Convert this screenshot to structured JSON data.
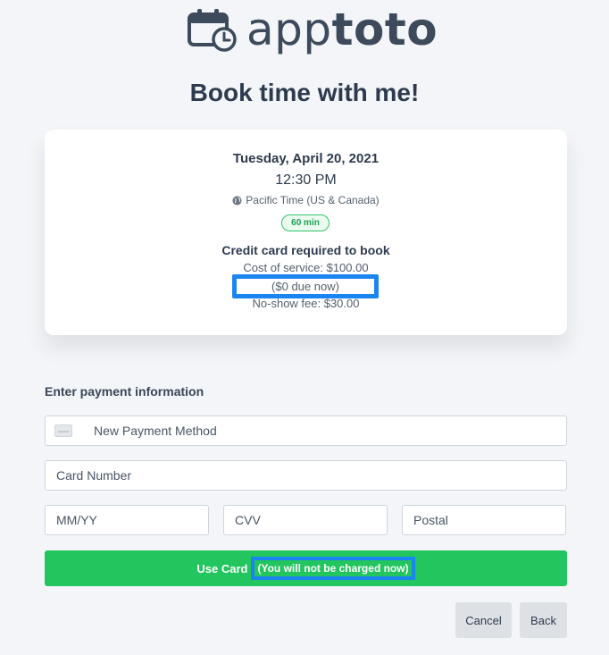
{
  "brand": {
    "name_light": "app",
    "name_bold": "toto",
    "accent": "#1a84f0",
    "primary_green": "#22c55e"
  },
  "page_title": "Book time with me!",
  "appointment": {
    "date": "Tuesday, April 20, 2021",
    "time": "12:30 PM",
    "timezone": "Pacific Time (US & Canada)",
    "duration": "60 min",
    "credit_card_heading": "Credit card required to book",
    "cost": "Cost of service: $100.00",
    "due_now": "($0 due now)",
    "no_show_fee": "No-show fee: $30.00"
  },
  "payment": {
    "section_label": "Enter payment information",
    "method_value": "New Payment Method",
    "card_number_placeholder": "Card Number",
    "expiry_placeholder": "MM/YY",
    "cvv_placeholder": "CVV",
    "postal_placeholder": "Postal"
  },
  "buttons": {
    "use_card": "Use Card",
    "use_card_note": "(You will not be charged now)",
    "cancel": "Cancel",
    "back": "Back"
  },
  "icons": {
    "logo": "calendar-clock-icon",
    "timezone": "globe-icon",
    "payment_method": "credit-card-icon"
  }
}
